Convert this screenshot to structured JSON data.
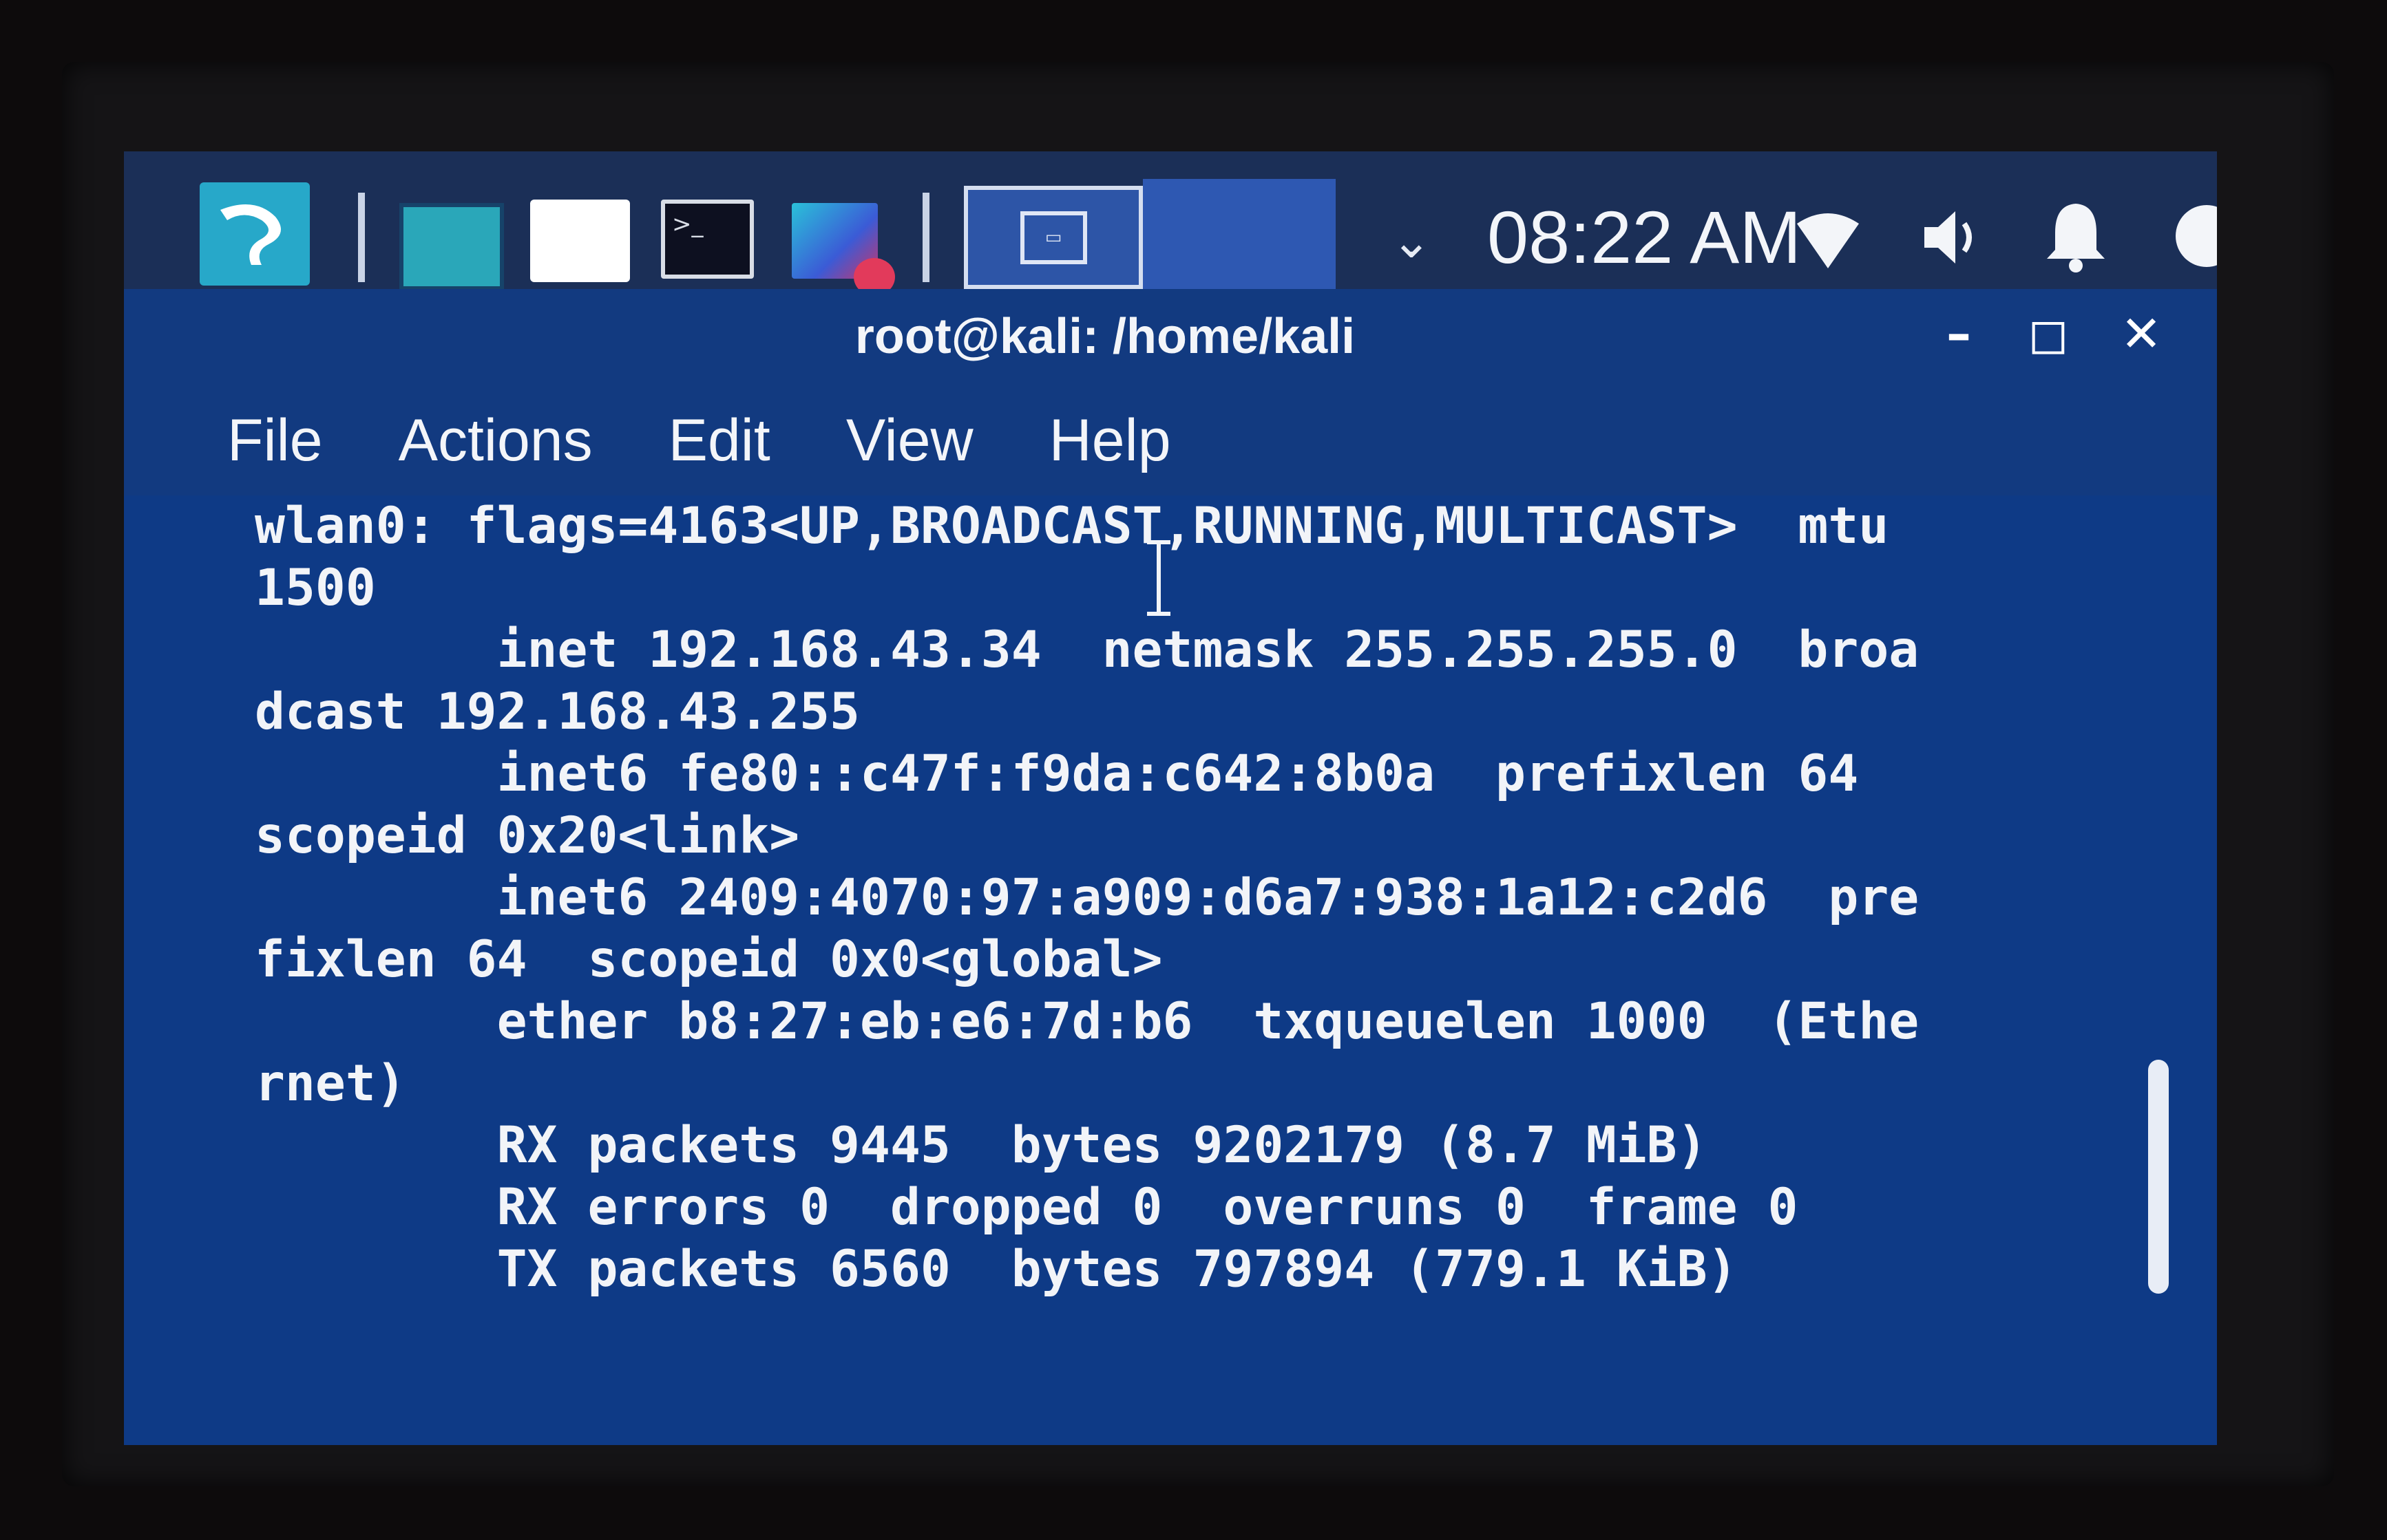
{
  "taskbar": {
    "launchers": [
      {
        "icon": "kali-menu-icon"
      },
      {
        "icon": "show-desktop-icon"
      },
      {
        "icon": "file-manager-icon"
      },
      {
        "icon": "terminal-icon"
      },
      {
        "icon": "screenshot-icon"
      }
    ],
    "terminal_glyph": ">_",
    "clock": "08:22 AM"
  },
  "window": {
    "title": "root@kali: /home/kali",
    "controls": {
      "minimize": "–",
      "maximize": "◻",
      "close": "✕"
    }
  },
  "menu": {
    "file": "File",
    "actions": "Actions",
    "edit": "Edit",
    "view": "View",
    "help": "Help"
  },
  "terminal": {
    "output": "wlan0: flags=4163<UP,BROADCAST,RUNNING,MULTICAST>  mtu\n1500\n        inet 192.168.43.34  netmask 255.255.255.0  broa\ndcast 192.168.43.255\n        inet6 fe80::c47f:f9da:c642:8b0a  prefixlen 64\nscopeid 0x20<link>\n        inet6 2409:4070:97:a909:d6a7:938:1a12:c2d6  pre\nfixlen 64  scopeid 0x0<global>\n        ether b8:27:eb:e6:7d:b6  txqueuelen 1000  (Ethe\nrnet)\n        RX packets 9445  bytes 9202179 (8.7 MiB)\n        RX errors 0  dropped 0  overruns 0  frame 0\n        TX packets 6560  bytes 797894 (779.1 KiB)"
  },
  "colors": {
    "taskbar": "#1b2f57",
    "terminal_background": "#0e3a86",
    "text": "#f2f4f8",
    "accent": "#27a8c9"
  }
}
